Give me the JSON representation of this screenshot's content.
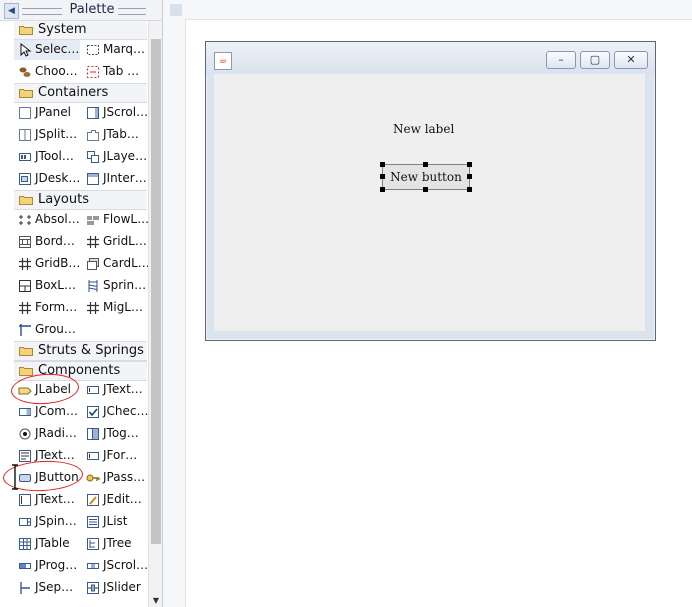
{
  "palette": {
    "title": "Palette",
    "categories": {
      "system": "System",
      "containers": "Containers",
      "layouts": "Layouts",
      "struts": "Struts & Springs",
      "components": "Components"
    },
    "items": {
      "selection": "Selec…",
      "marquee": "Marq…",
      "choose_component": "Choo…",
      "tab_order": "Tab …",
      "jpanel": "JPanel",
      "jscrollpane": "JScrol…",
      "jsplitpane": "JSplit…",
      "jtabbedpane": "JTab…",
      "jtoolbar": "JTool…",
      "jlayeredpane": "JLaye…",
      "jdesktoppane": "JDesk…",
      "jinternalframe": "JInter…",
      "absolute_layout": "Absol…",
      "flow_layout": "FlowL…",
      "border_layout": "Bord…",
      "grid_layout": "GridL…",
      "gridbag_layout": "GridB…",
      "card_layout": "CardL…",
      "box_layout": "BoxL…",
      "spring_layout": "Sprin…",
      "form_layout": "Form…",
      "mig_layout": "MigL…",
      "group_layout": "Grou…",
      "jlabel": "JLabel",
      "jtextfield": "JText…",
      "jcombobox": "JCom…",
      "jcheckbox": "JChec…",
      "jradiobutton": "JRadi…",
      "jtogglebutton": "JTog…",
      "jtextarea": "JText…",
      "jformattedtextfield": "JFor…",
      "jbutton": "JButton",
      "jpasswordfield": "JPass…",
      "jtextpane": "JText…",
      "jeditorpane": "JEdit…",
      "jspinner": "JSpin…",
      "jlist": "JList",
      "jtable": "JTable",
      "jtree": "JTree",
      "jprogressbar": "JProg…",
      "jscrollbar": "JScrol…",
      "jseparator": "JSep…",
      "jslider": "JSlider"
    }
  },
  "design": {
    "label_text": "New label",
    "button_text": "New button",
    "window_buttons": {
      "minimize": "–",
      "maximize": "▢",
      "close": "✕"
    }
  },
  "colors": {
    "annotation_red": "#e02020",
    "selection_bg": "#e6ecf6",
    "frame_bg": "#dbe3ee"
  }
}
